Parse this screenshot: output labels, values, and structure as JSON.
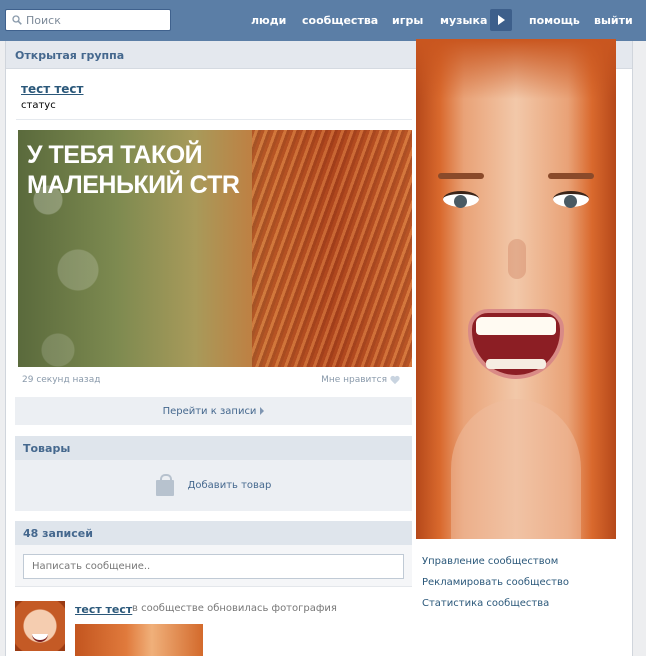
{
  "topbar": {
    "search_placeholder": "Поиск",
    "nav": [
      "люди",
      "сообщества",
      "игры",
      "музыка",
      "помощь",
      "выйти"
    ]
  },
  "group": {
    "header": "Открытая группа",
    "name": "тест тест",
    "status": "статус"
  },
  "post": {
    "headline": "У ТЕБЯ ТАКОЙ МАЛЕНЬКИЙ CTR",
    "time": "29 секунд назад",
    "like_label": "Мне нравится",
    "goto_label": "Перейти к записи"
  },
  "goods": {
    "title": "Товары",
    "add_label": "Добавить товар"
  },
  "posts": {
    "count_label": "48 записей",
    "input_placeholder": "Написать сообщение.."
  },
  "feed": {
    "author": "тест тест",
    "action": "в сообществе обновилась фотография"
  },
  "side_links": [
    "Управление сообществом",
    "Рекламировать сообщество",
    "Статистика сообщества"
  ],
  "colors": {
    "topbar": "#5b7ea6",
    "link": "#2b587a",
    "header_bg": "#e4e8ee"
  }
}
